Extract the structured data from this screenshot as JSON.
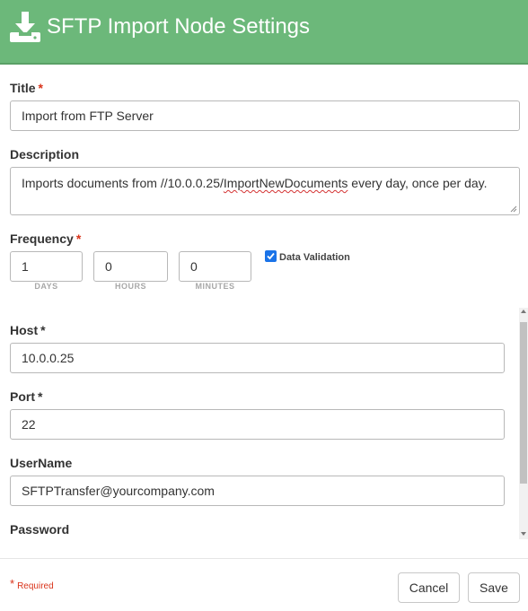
{
  "header": {
    "icon": "download-icon",
    "title": "SFTP Import Node Settings",
    "color": "#6cb87a"
  },
  "form": {
    "title": {
      "label": "Title",
      "required_mark": "*",
      "value": "Import from FTP Server"
    },
    "description": {
      "label": "Description",
      "value_before": "Imports documents from //10.0.0.25/",
      "value_misspelled": "ImportNewDocuments",
      "value_after": " every day, once per day."
    },
    "frequency": {
      "label": "Frequency",
      "required_mark": "*",
      "days": {
        "value": "1",
        "unit": "DAYS"
      },
      "hours": {
        "value": "0",
        "unit": "HOURS"
      },
      "minutes": {
        "value": "0",
        "unit": "MINUTES"
      }
    },
    "data_validation": {
      "label": "Data Validation",
      "checked": true
    },
    "host": {
      "label": "Host",
      "required_mark": "*",
      "value": "10.0.0.25"
    },
    "port": {
      "label": "Port",
      "required_mark": "*",
      "value": "22"
    },
    "username": {
      "label": "UserName",
      "value": "SFTPTransfer@yourcompany.com"
    },
    "password": {
      "label": "Password"
    }
  },
  "footer": {
    "required_star": "*",
    "required_text": "Required",
    "cancel_label": "Cancel",
    "save_label": "Save"
  }
}
